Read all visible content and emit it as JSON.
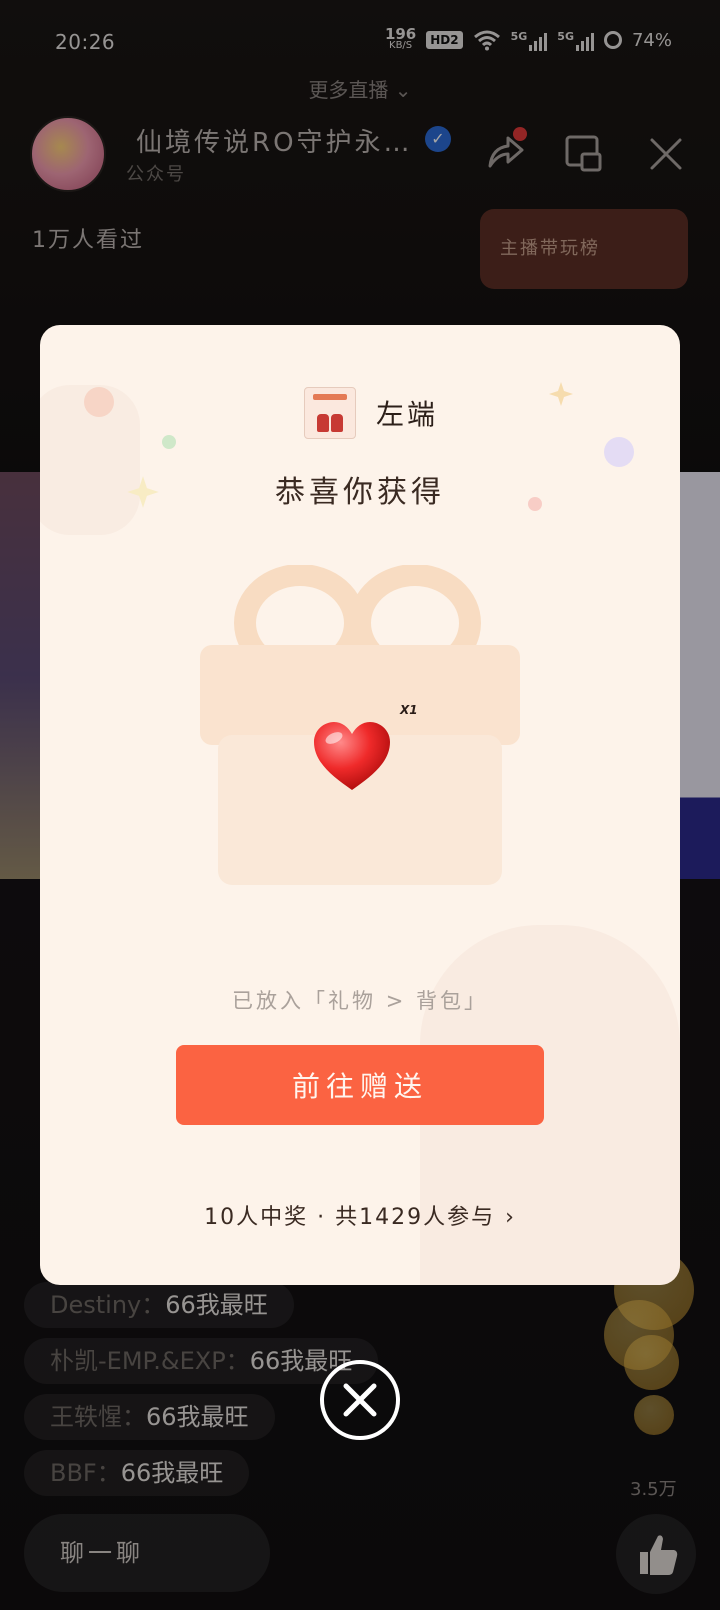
{
  "status_bar": {
    "time": "20:26",
    "net_speed": "196",
    "net_unit": "KB/S",
    "hd": "HD2",
    "signal1_label": "5G",
    "signal2_label": "5G",
    "battery": "74%"
  },
  "header": {
    "more_live": "更多直播",
    "channel_name": "仙境传说RO守护永…",
    "channel_sub": "公众号",
    "viewers": "1万人看过",
    "rank_button": "主播带玩榜"
  },
  "comments": [
    {
      "nick": "Destiny：",
      "text": "66我最旺"
    },
    {
      "nick": "朴凯-EMP.&EXP：",
      "text": "66我最旺"
    },
    {
      "nick": "王轶惺：",
      "text": "66我最旺"
    },
    {
      "nick": "BBF：",
      "text": "66我最旺"
    }
  ],
  "bottom": {
    "chat_placeholder": "聊一聊",
    "like_count": "3.5万"
  },
  "modal": {
    "brand_name": "左端",
    "title": "恭喜你获得",
    "gift_qty": "X1",
    "hint": "已放入「礼物 > 背包」",
    "send_button": "前往赠送",
    "winners": "10人中奖 · 共1429人参与"
  },
  "colors": {
    "accent": "#fb6342",
    "modal_bg": "#fdf3ea",
    "verified": "#2c6bd6"
  }
}
